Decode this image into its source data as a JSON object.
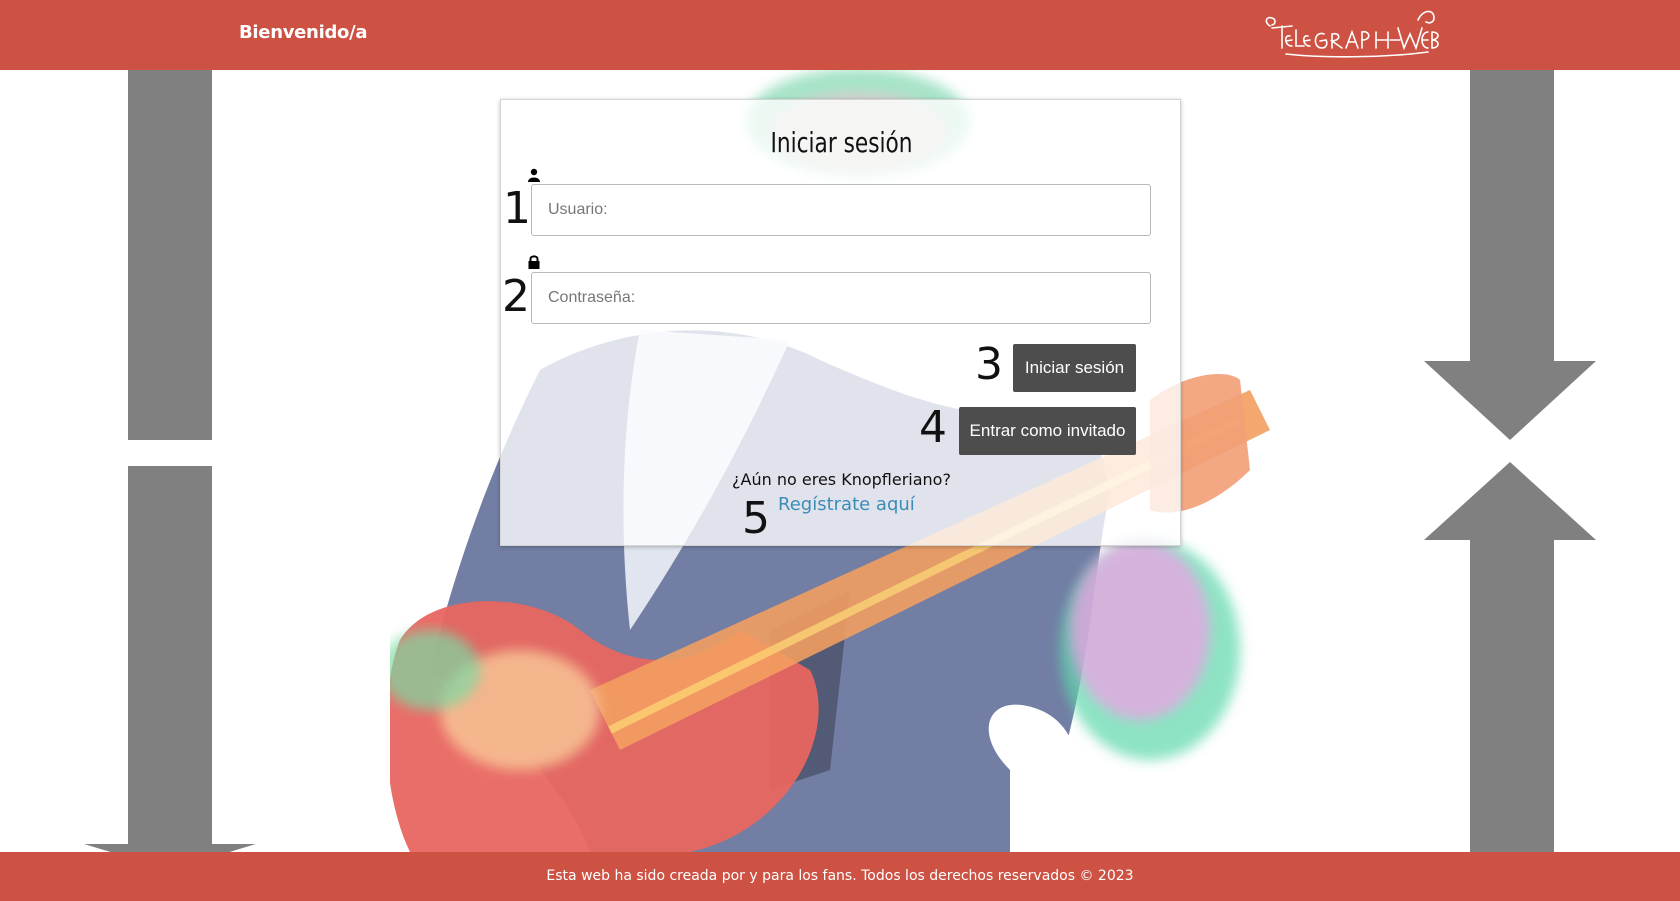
{
  "header": {
    "welcome": "Bienvenido/a",
    "logo_text": "TELEGRAPH WEB"
  },
  "login": {
    "title": "Iniciar sesión",
    "username_number": "1",
    "username_placeholder": "Usuario:",
    "password_number": "2",
    "password_placeholder": "Contraseña:",
    "login_number": "3",
    "login_label": "Iniciar sesión",
    "guest_number": "4",
    "guest_label": "Entrar como invitado",
    "question": "¿Aún no eres Knopfleriano?",
    "register_number": "5",
    "register_label": "Regístrate aquí"
  },
  "footer": {
    "text": "Esta web ha sido creada por y para los fans. Todos los derechos reservados © 2023"
  },
  "colors": {
    "brand": "#cd5243",
    "button": "#4d4d4d",
    "link": "#3c8cb8",
    "side_art": "#808080"
  },
  "icons": {
    "username": "user-icon",
    "password": "lock-icon"
  }
}
